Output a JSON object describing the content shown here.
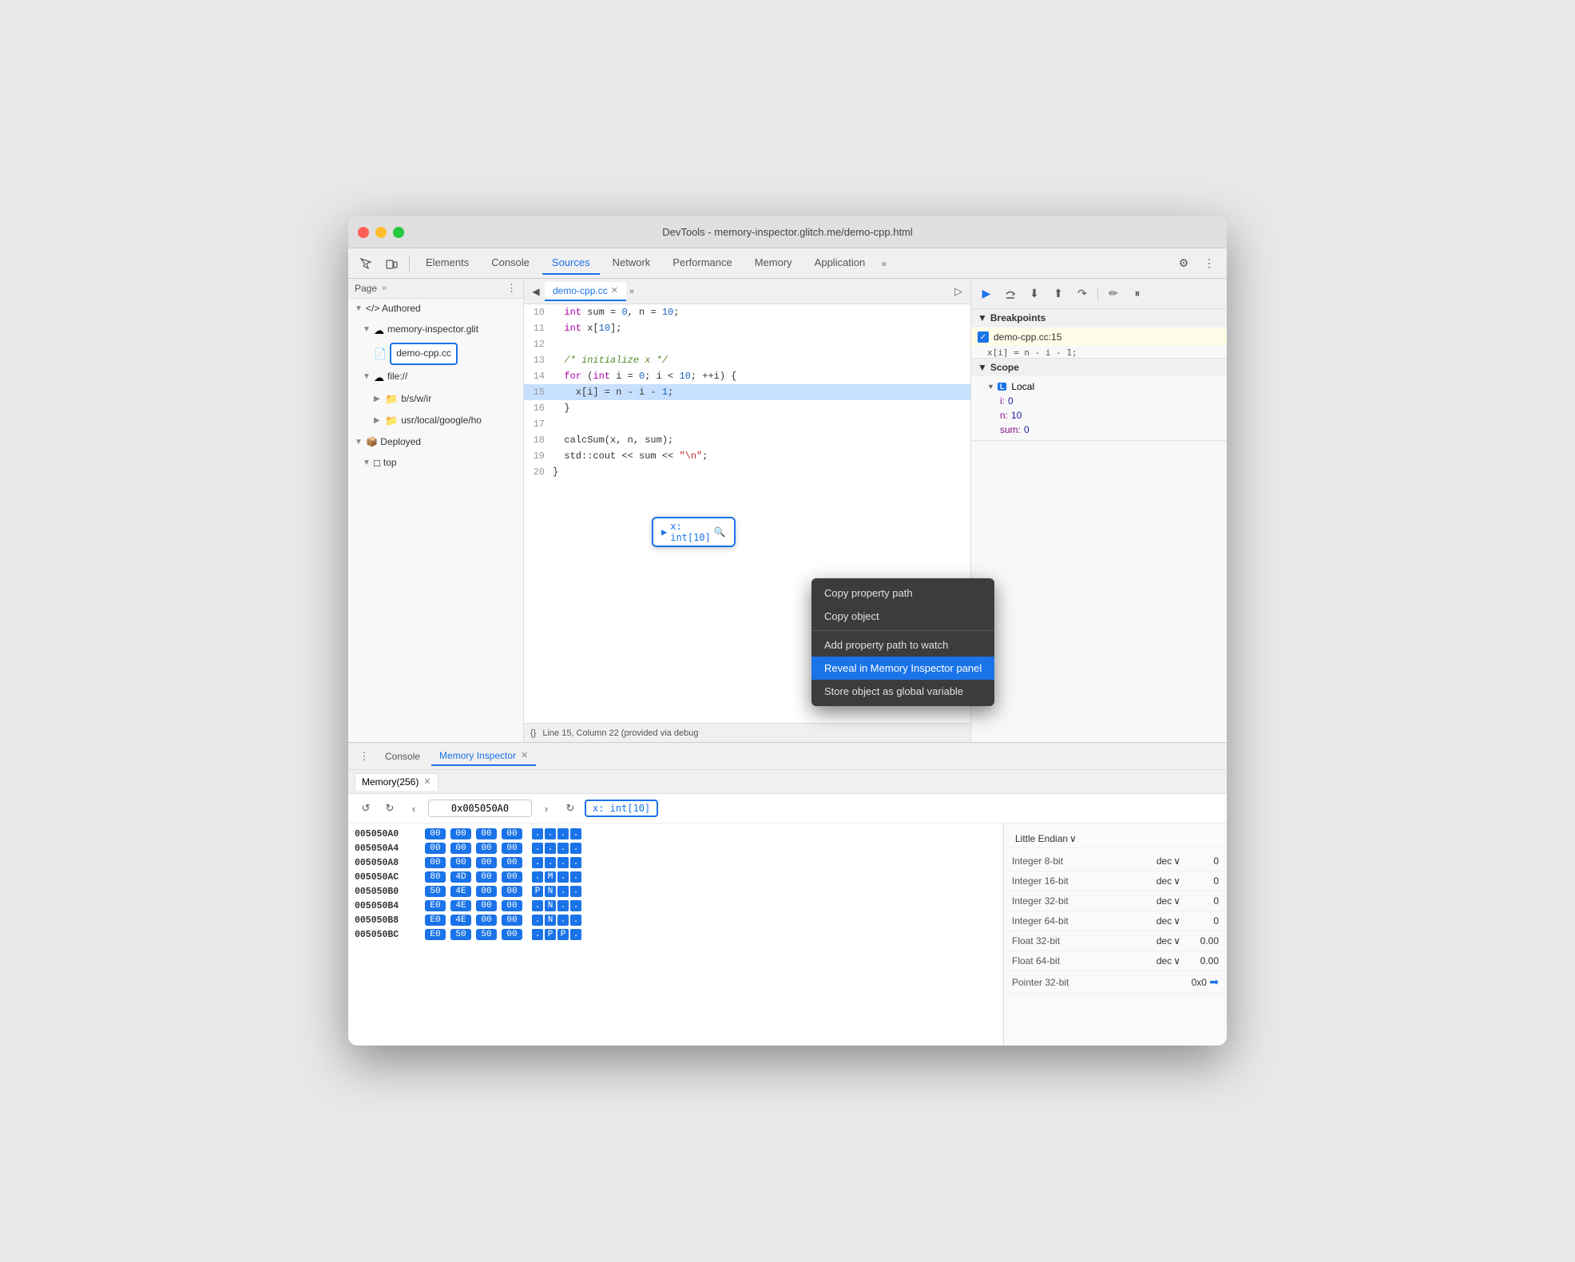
{
  "window": {
    "title": "DevTools - memory-inspector.glitch.me/demo-cpp.html"
  },
  "titlebar": {
    "traffic_lights": [
      "red",
      "yellow",
      "green"
    ]
  },
  "toolbar": {
    "tabs": [
      {
        "label": "Elements",
        "active": false
      },
      {
        "label": "Console",
        "active": false
      },
      {
        "label": "Sources",
        "active": true
      },
      {
        "label": "Network",
        "active": false
      },
      {
        "label": "Performance",
        "active": false
      },
      {
        "label": "Memory",
        "active": false
      },
      {
        "label": "Application",
        "active": false
      }
    ],
    "overflow_label": "»",
    "settings_icon": "⚙",
    "more_icon": "⋮"
  },
  "sidebar": {
    "label": "Page",
    "overflow": "»",
    "tree": [
      {
        "level": 0,
        "icon": "</> Authored",
        "label": "",
        "arrow": "▼",
        "type": "section"
      },
      {
        "level": 1,
        "icon": "☁",
        "label": "memory-inspector.glit",
        "arrow": "▼"
      },
      {
        "level": 2,
        "icon": "📄",
        "label": "demo-cpp.cc",
        "highlighted": true
      },
      {
        "level": 1,
        "icon": "☁",
        "label": "file://",
        "arrow": "▼"
      },
      {
        "level": 2,
        "icon": "📁",
        "label": "b/s/w/ir",
        "arrow": "▶"
      },
      {
        "level": 2,
        "icon": "📁",
        "label": "usr/local/google/ho",
        "arrow": "▶"
      },
      {
        "level": 0,
        "icon": "📦 Deployed",
        "label": "",
        "arrow": "▼",
        "type": "section"
      },
      {
        "level": 1,
        "icon": "□",
        "label": "top",
        "arrow": "▼"
      }
    ]
  },
  "source": {
    "tab": "demo-cpp.cc",
    "lines": [
      {
        "num": 10,
        "content": "  int sum = 0, n = 10;"
      },
      {
        "num": 11,
        "content": "  int x[10];"
      },
      {
        "num": 12,
        "content": ""
      },
      {
        "num": 13,
        "content": "  /* initialize x */"
      },
      {
        "num": 14,
        "content": "  for (int i = 0; i < 10; ++i) {"
      },
      {
        "num": 15,
        "content": "    x[i] = n - i - 1;",
        "active": true
      },
      {
        "num": 16,
        "content": "  }"
      },
      {
        "num": 17,
        "content": ""
      },
      {
        "num": 18,
        "content": "  calcSum(x, n, sum);"
      },
      {
        "num": 19,
        "content": "  std::cout << sum << \"\\n\";"
      },
      {
        "num": 20,
        "content": "}"
      }
    ],
    "statusbar": "Line 15, Column 22 (provided via debug"
  },
  "right_panel": {
    "debug_buttons": [
      "▶",
      "↺",
      "⬇",
      "⬆",
      "↷",
      "✏",
      "⏸"
    ],
    "breakpoints": {
      "header": "Breakpoints",
      "items": [
        {
          "file": "demo-cpp.cc:15",
          "code": "x[i] = n - i - 1;"
        }
      ]
    },
    "scope": {
      "header": "Scope",
      "sections": [
        {
          "label": "Local",
          "badge": "L",
          "items": [
            {
              "key": "i:",
              "val": "0"
            },
            {
              "key": "n:",
              "val": "10"
            },
            {
              "key": "sum:",
              "val": "0"
            }
          ]
        }
      ]
    }
  },
  "bottom": {
    "tabs": [
      {
        "label": "Console",
        "active": false
      },
      {
        "label": "Memory Inspector",
        "active": true
      }
    ],
    "memory": {
      "tab_label": "Memory(256)",
      "address": "0x005050A0",
      "highlight_badge": "x: int[10]",
      "endian": "Little Endian",
      "rows": [
        {
          "addr": "005050A0",
          "bytes": [
            "00",
            "00",
            "00",
            "00"
          ],
          "chars": [
            ".",
            ".",
            ".",
            "."
          ]
        },
        {
          "addr": "005050A4",
          "bytes": [
            "00",
            "00",
            "00",
            "00"
          ],
          "chars": [
            ".",
            ".",
            ".",
            "."
          ]
        },
        {
          "addr": "005050A8",
          "bytes": [
            "00",
            "00",
            "00",
            "00"
          ],
          "chars": [
            ".",
            ".",
            ".",
            "."
          ]
        },
        {
          "addr": "005050AC",
          "bytes": [
            "80",
            "4D",
            "00",
            "00"
          ],
          "chars": [
            ".",
            "M",
            ".",
            "."
          ]
        },
        {
          "addr": "005050B0",
          "bytes": [
            "50",
            "4E",
            "00",
            "00"
          ],
          "chars": [
            "P",
            "N",
            ".",
            "."
          ]
        },
        {
          "addr": "005050B4",
          "bytes": [
            "E0",
            "4E",
            "00",
            "00"
          ],
          "chars": [
            ".",
            "N",
            ".",
            "."
          ]
        },
        {
          "addr": "005050B8",
          "bytes": [
            "E0",
            "4E",
            "00",
            "00"
          ],
          "chars": [
            ".",
            "N",
            ".",
            "."
          ]
        },
        {
          "addr": "005050BC",
          "bytes": [
            "E0",
            "50",
            "50",
            "00"
          ],
          "chars": [
            ".",
            "P",
            "P",
            "."
          ]
        }
      ],
      "info": {
        "endian_label": "Little Endian",
        "rows": [
          {
            "type": "Integer 8-bit",
            "format": "dec",
            "value": "0"
          },
          {
            "type": "Integer 16-bit",
            "format": "dec",
            "value": "0"
          },
          {
            "type": "Integer 32-bit",
            "format": "dec",
            "value": "0"
          },
          {
            "type": "Integer 64-bit",
            "format": "dec",
            "value": "0"
          },
          {
            "type": "Float 32-bit",
            "format": "dec",
            "value": "0.00"
          },
          {
            "type": "Float 64-bit",
            "format": "dec",
            "value": "0.00"
          },
          {
            "type": "Pointer 32-bit",
            "format": "",
            "value": "0x0"
          }
        ]
      }
    }
  },
  "context_menu": {
    "items": [
      {
        "label": "Copy property path",
        "active": false,
        "has_sep_after": false
      },
      {
        "label": "Copy object",
        "active": false,
        "has_sep_after": true
      },
      {
        "label": "Add property path to watch",
        "active": false,
        "has_sep_after": false
      },
      {
        "label": "Reveal in Memory Inspector panel",
        "active": true,
        "has_sep_after": false
      },
      {
        "label": "Store object as global variable",
        "active": false,
        "has_sep_after": false
      }
    ]
  },
  "scope_badge": {
    "label": "x: int[10]",
    "arrow": "▶",
    "icon": "🔍"
  }
}
